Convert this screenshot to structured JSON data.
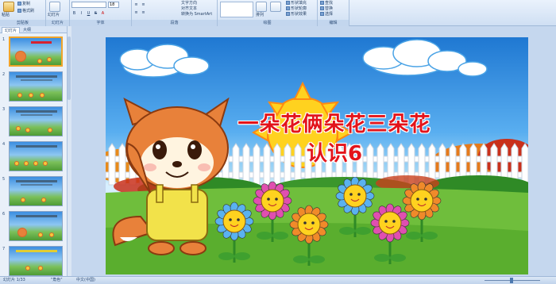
{
  "ribbon": {
    "groups": [
      {
        "label": "剪贴板",
        "buttons": [
          "粘贴",
          "复制",
          "格式刷"
        ]
      },
      {
        "label": "幻灯片",
        "buttons": [
          "新建",
          "幻灯片",
          "版式",
          "重设",
          "删除"
        ]
      },
      {
        "label": "字体",
        "buttons": [
          "B",
          "I",
          "U",
          "S",
          "A"
        ]
      },
      {
        "label": "段落",
        "buttons": [
          "文字方向",
          "对齐文本",
          "转换为 SmartArt"
        ]
      },
      {
        "label": "绘图",
        "buttons": [
          "排列",
          "快速样式",
          "形状填充",
          "形状轮廓",
          "形状效果"
        ]
      },
      {
        "label": "编辑",
        "buttons": [
          "查找",
          "替换",
          "选择"
        ]
      }
    ],
    "font_size": "18"
  },
  "panel_tabs": [
    "幻灯片",
    "大纲"
  ],
  "thumbnails": [
    "1",
    "2",
    "3",
    "4",
    "5",
    "6",
    "7"
  ],
  "slide": {
    "title_line1": "一朵花俩朵花三朵花",
    "title_line2": "认识6"
  },
  "status": {
    "slide_counter": "幻灯片 1/33",
    "theme": "\"角色\"",
    "language": "中文(中国)"
  },
  "colors": {
    "title_red": "#e3141b",
    "sky": "#1f78d2",
    "grass": "#4e9b36",
    "selection": "#f0a42a"
  }
}
